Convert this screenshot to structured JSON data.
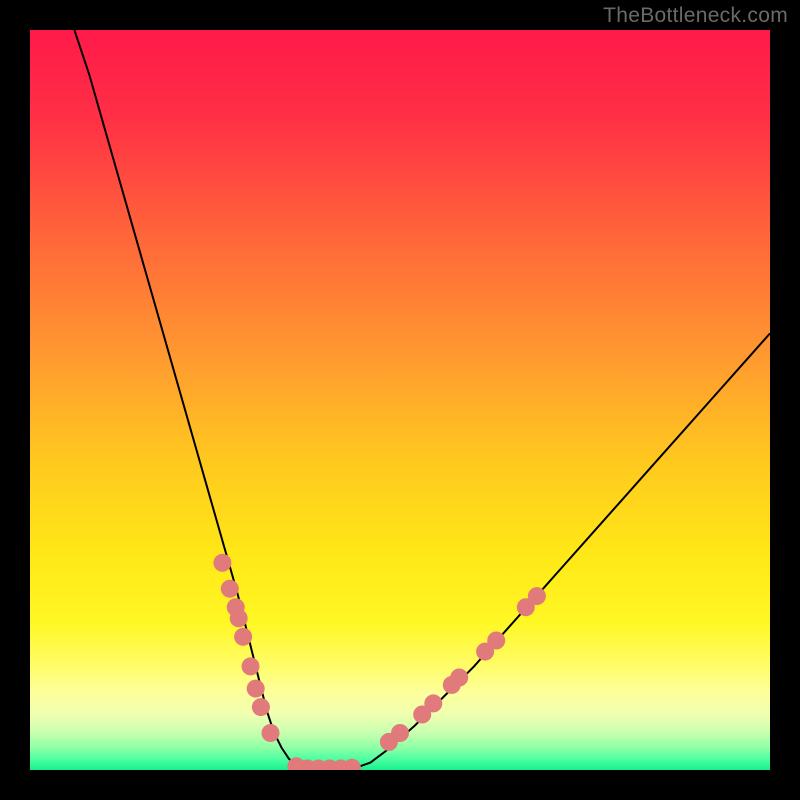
{
  "watermark": "TheBottleneck.com",
  "chart_data": {
    "type": "line",
    "title": "",
    "xlabel": "",
    "ylabel": "",
    "xlim": [
      0,
      100
    ],
    "ylim": [
      0,
      100
    ],
    "grid": false,
    "series": [
      {
        "name": "curve",
        "x": [
          6,
          8,
          10,
          12,
          14,
          16,
          18,
          20,
          22,
          24,
          26,
          27,
          28,
          29,
          30,
          31,
          32,
          33,
          34,
          35,
          36,
          37,
          38,
          40,
          42,
          44,
          46,
          48,
          52,
          56,
          60,
          64,
          68,
          72,
          76,
          80,
          84,
          88,
          92,
          96,
          100
        ],
        "y": [
          100,
          94,
          87,
          80,
          73,
          66,
          59,
          52,
          45,
          38,
          31,
          27.5,
          24,
          20,
          16,
          12,
          8,
          5,
          3,
          1.5,
          0.7,
          0.3,
          0,
          0,
          0,
          0.3,
          1,
          2.5,
          6,
          10,
          14,
          18.5,
          23,
          27.5,
          32,
          36.5,
          41,
          45.5,
          50,
          54.5,
          59
        ],
        "color": "#000000"
      }
    ],
    "marker_groups": [
      {
        "name": "left-cluster-markers",
        "color": "#e17a7a",
        "points": [
          {
            "x": 26.0,
            "y": 28.0
          },
          {
            "x": 27.0,
            "y": 24.5
          },
          {
            "x": 27.8,
            "y": 22.0
          },
          {
            "x": 28.2,
            "y": 20.5
          },
          {
            "x": 28.8,
            "y": 18.0
          },
          {
            "x": 29.8,
            "y": 14.0
          },
          {
            "x": 30.5,
            "y": 11.0
          },
          {
            "x": 31.2,
            "y": 8.5
          },
          {
            "x": 32.5,
            "y": 5.0
          }
        ]
      },
      {
        "name": "bottom-cluster-markers",
        "color": "#e17a7a",
        "points": [
          {
            "x": 36.0,
            "y": 0.5
          },
          {
            "x": 37.5,
            "y": 0.2
          },
          {
            "x": 39.0,
            "y": 0.2
          },
          {
            "x": 40.5,
            "y": 0.2
          },
          {
            "x": 42.0,
            "y": 0.2
          },
          {
            "x": 43.5,
            "y": 0.3
          }
        ]
      },
      {
        "name": "right-cluster-markers",
        "color": "#e17a7a",
        "points": [
          {
            "x": 48.5,
            "y": 3.8
          },
          {
            "x": 50.0,
            "y": 5.0
          },
          {
            "x": 53.0,
            "y": 7.5
          },
          {
            "x": 54.5,
            "y": 9.0
          },
          {
            "x": 57.0,
            "y": 11.5
          },
          {
            "x": 58.0,
            "y": 12.5
          },
          {
            "x": 61.5,
            "y": 16.0
          },
          {
            "x": 63.0,
            "y": 17.5
          },
          {
            "x": 67.0,
            "y": 22.0
          },
          {
            "x": 68.5,
            "y": 23.5
          }
        ]
      }
    ],
    "background_gradient": {
      "stops": [
        {
          "pos": 0.0,
          "color": "#ff1a4a"
        },
        {
          "pos": 0.12,
          "color": "#ff3045"
        },
        {
          "pos": 0.28,
          "color": "#ff663a"
        },
        {
          "pos": 0.44,
          "color": "#ff9930"
        },
        {
          "pos": 0.58,
          "color": "#ffc81f"
        },
        {
          "pos": 0.71,
          "color": "#ffe817"
        },
        {
          "pos": 0.8,
          "color": "#fff724"
        },
        {
          "pos": 0.855,
          "color": "#fffc63"
        },
        {
          "pos": 0.895,
          "color": "#fdff9b"
        },
        {
          "pos": 0.925,
          "color": "#f0ffb0"
        },
        {
          "pos": 0.95,
          "color": "#c7ffb0"
        },
        {
          "pos": 0.97,
          "color": "#8effa6"
        },
        {
          "pos": 0.985,
          "color": "#4effa0"
        },
        {
          "pos": 1.0,
          "color": "#18f08f"
        }
      ]
    }
  }
}
